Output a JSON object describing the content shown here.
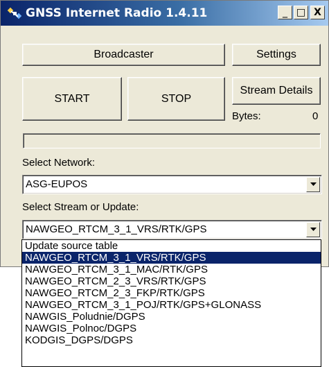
{
  "window": {
    "title": "GNSS Internet Radio 1.4.11",
    "controls": {
      "minimize": "_",
      "maximize": "□",
      "close": "X"
    }
  },
  "buttons": {
    "broadcaster": "Broadcaster",
    "settings": "Settings",
    "start": "START",
    "stop": "STOP",
    "stream_details": "Stream Details"
  },
  "bytes": {
    "label": "Bytes:",
    "value": "0"
  },
  "network": {
    "label": "Select Network:",
    "value": "ASG-EUPOS"
  },
  "stream": {
    "label": "Select Stream or Update:",
    "value": "NAWGEO_RTCM_3_1_VRS/RTK/GPS"
  },
  "dropdown_items": [
    "Update source table",
    "NAWGEO_RTCM_3_1_VRS/RTK/GPS",
    "NAWGEO_RTCM_3_1_MAC/RTK/GPS",
    "NAWGEO_RTCM_2_3_VRS/RTK/GPS",
    "NAWGEO_RTCM_2_3_FKP/RTK/GPS",
    "NAWGEO_RTCM_3_1_POJ/RTK/GPS+GLONASS",
    "NAWGIS_Poludnie/DGPS",
    "NAWGIS_Polnoc/DGPS",
    "KODGIS_DGPS/DGPS"
  ],
  "selected_index": 1,
  "colors": {
    "title_start": "#0a246a",
    "title_end": "#a6caf0",
    "selection": "#0a246a",
    "face": "#ece9d8"
  }
}
